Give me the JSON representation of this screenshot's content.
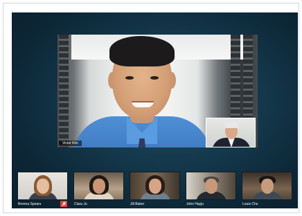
{
  "main": {
    "speaker_name": "Victor Kim"
  },
  "participants": [
    {
      "name": "Brenna Spears",
      "muted": true
    },
    {
      "name": "Clara Ju",
      "muted": false
    },
    {
      "name": "Jill Baker",
      "muted": false
    },
    {
      "name": "John Hayju",
      "muted": false
    },
    {
      "name": "Louis Cho",
      "muted": false
    }
  ],
  "icons": {
    "mute": "mic-muted-icon"
  },
  "colors": {
    "background": "#153a4e",
    "mute_badge": "#e23a3a"
  }
}
